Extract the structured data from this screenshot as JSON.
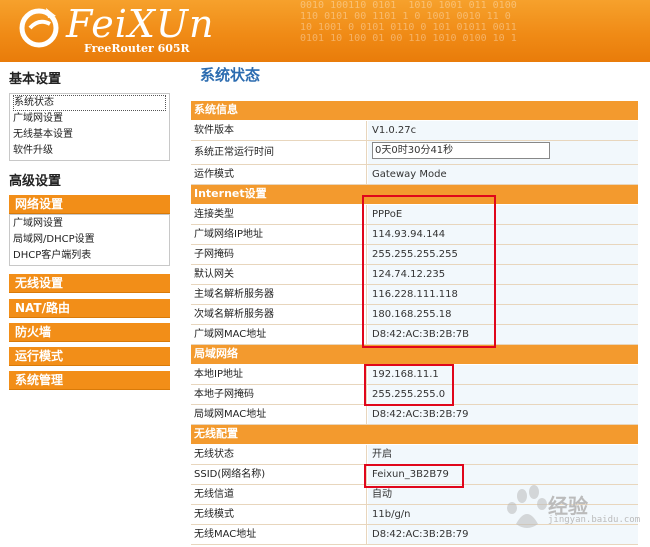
{
  "header": {
    "brand": "FeiXUn",
    "model": "FreeRouter 605R",
    "binary_bg": "0010 100110 0101  1010 1001 011 0100\n110 0101 00 1101 1 0 1001 0010 11 0\n10 1001 0 0101 0110 0 101 01011 0011\n0101 10 100 01 00 110 1010 0100 10 1"
  },
  "sidebar": {
    "basic_title": "基本设置",
    "basic_items": [
      "系统状态",
      "广域网设置",
      "无线基本设置",
      "软件升级"
    ],
    "advanced_title": "高级设置",
    "network_header": "网络设置",
    "network_items": [
      "广域网设置",
      "局域网/DHCP设置",
      "DHCP客户端列表"
    ],
    "menu": [
      "无线设置",
      "NAT/路由",
      "防火墙",
      "运行模式",
      "系统管理"
    ]
  },
  "main": {
    "title": "系统状态",
    "system": {
      "header": "系统信息",
      "rows": [
        {
          "label": "软件版本",
          "value": "V1.0.27c"
        },
        {
          "label": "系统正常运行时间",
          "value": "0天0时30分41秒"
        },
        {
          "label": "运作模式",
          "value": "Gateway Mode"
        }
      ]
    },
    "internet": {
      "header": "Internet设置",
      "rows": [
        {
          "label": "连接类型",
          "value": "PPPoE"
        },
        {
          "label": "广域网络IP地址",
          "value": "114.93.94.144"
        },
        {
          "label": "子网掩码",
          "value": "255.255.255.255"
        },
        {
          "label": "默认网关",
          "value": "124.74.12.235"
        },
        {
          "label": "主域名解析服务器",
          "value": "116.228.111.118"
        },
        {
          "label": "次域名解析服务器",
          "value": "180.168.255.18"
        },
        {
          "label": "广域网MAC地址",
          "value": "D8:42:AC:3B:2B:7B"
        }
      ]
    },
    "lan": {
      "header": "局域网络",
      "rows": [
        {
          "label": "本地IP地址",
          "value": "192.168.11.1"
        },
        {
          "label": "本地子网掩码",
          "value": "255.255.255.0"
        },
        {
          "label": "局域网MAC地址",
          "value": "D8:42:AC:3B:2B:79"
        }
      ]
    },
    "wireless": {
      "header": "无线配置",
      "rows": [
        {
          "label": "无线状态",
          "value": "开启"
        },
        {
          "label": "SSID(网络名称)",
          "value": "Feixun_3B2B79"
        },
        {
          "label": "无线信道",
          "value": "自动"
        },
        {
          "label": "无线模式",
          "value": "11b/g/n"
        },
        {
          "label": "无线MAC地址",
          "value": "D8:42:AC:3B:2B:79"
        }
      ]
    }
  },
  "watermark": {
    "text": "经验",
    "sub": "jingyan.baidu.com"
  },
  "colors": {
    "accent": "#f28e18",
    "highlight": "#e0061b",
    "title": "#2c6cb0"
  }
}
